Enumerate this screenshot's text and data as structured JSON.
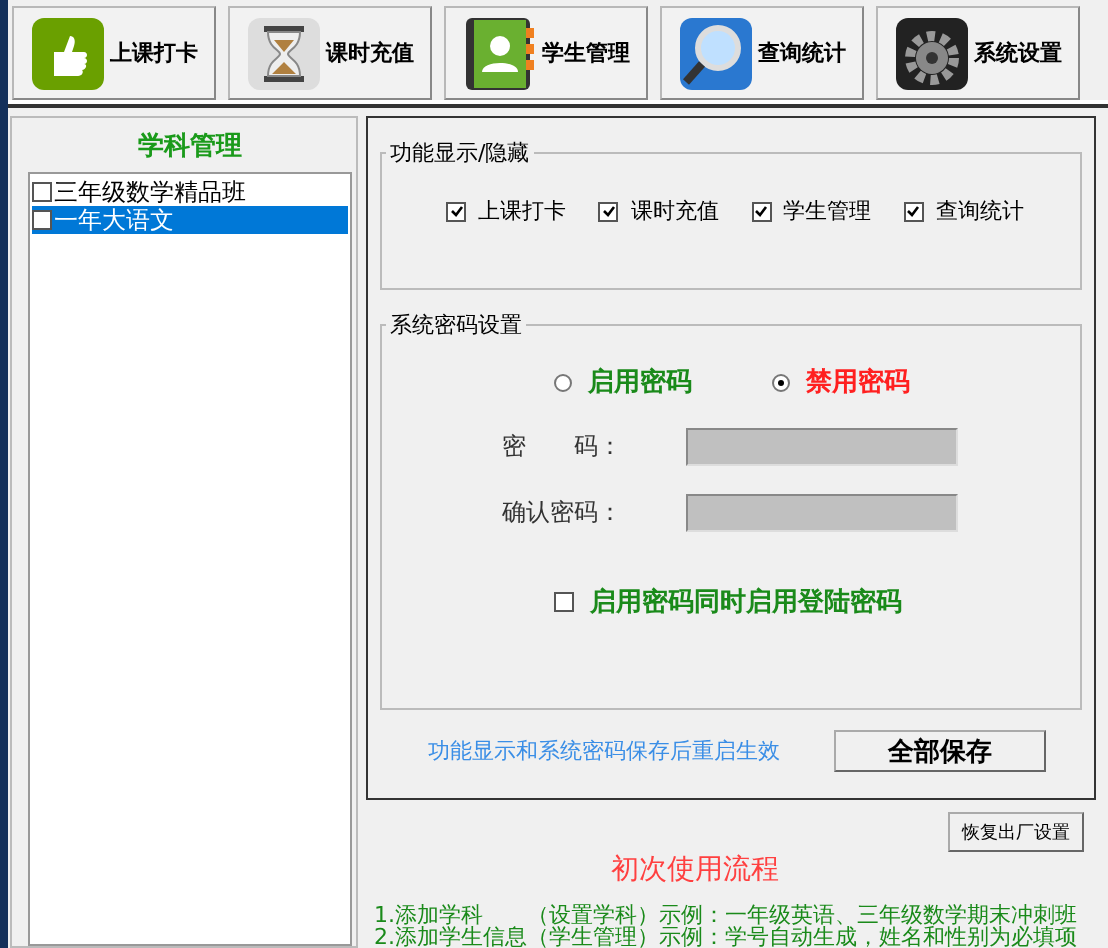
{
  "toolbar": {
    "buttons": [
      {
        "label": "上课打卡",
        "kind": "thumb"
      },
      {
        "label": "课时充值",
        "kind": "hourglass"
      },
      {
        "label": "学生管理",
        "kind": "contacts"
      },
      {
        "label": "查询统计",
        "kind": "search"
      },
      {
        "label": "系统设置",
        "kind": "gear"
      }
    ]
  },
  "sidebar": {
    "title": "学科管理",
    "items": [
      {
        "label": "三年级数学精品班",
        "checked": false,
        "selected": false
      },
      {
        "label": "一年大语文",
        "checked": false,
        "selected": true
      }
    ]
  },
  "feature_group": {
    "title": "功能显示/隐藏",
    "options": [
      {
        "label": "上课打卡",
        "checked": true
      },
      {
        "label": "课时充值",
        "checked": true
      },
      {
        "label": "学生管理",
        "checked": true
      },
      {
        "label": "查询统计",
        "checked": true
      }
    ]
  },
  "password_group": {
    "title": "系统密码设置",
    "modes": [
      {
        "label": "启用密码",
        "selected": false,
        "color": "#1a8a1a"
      },
      {
        "label": "禁用密码",
        "selected": true,
        "color": "#ff2020"
      }
    ],
    "fields": [
      {
        "label": "密　　码："
      },
      {
        "label": "确认密码："
      }
    ],
    "login_option": {
      "label": "启用密码同时启用登陆密码",
      "checked": false
    }
  },
  "note": "功能显示和系统密码保存后重启生效",
  "save_button": "全部保存",
  "reset_button": "恢复出厂设置",
  "guide": {
    "title": "初次使用流程",
    "steps": [
      "1.添加学科　　（设置学科）示例：一年级英语、三年级数学期末冲刺班",
      "2.添加学生信息（学生管理）示例：学号自动生成，姓名和性别为必填项"
    ]
  }
}
